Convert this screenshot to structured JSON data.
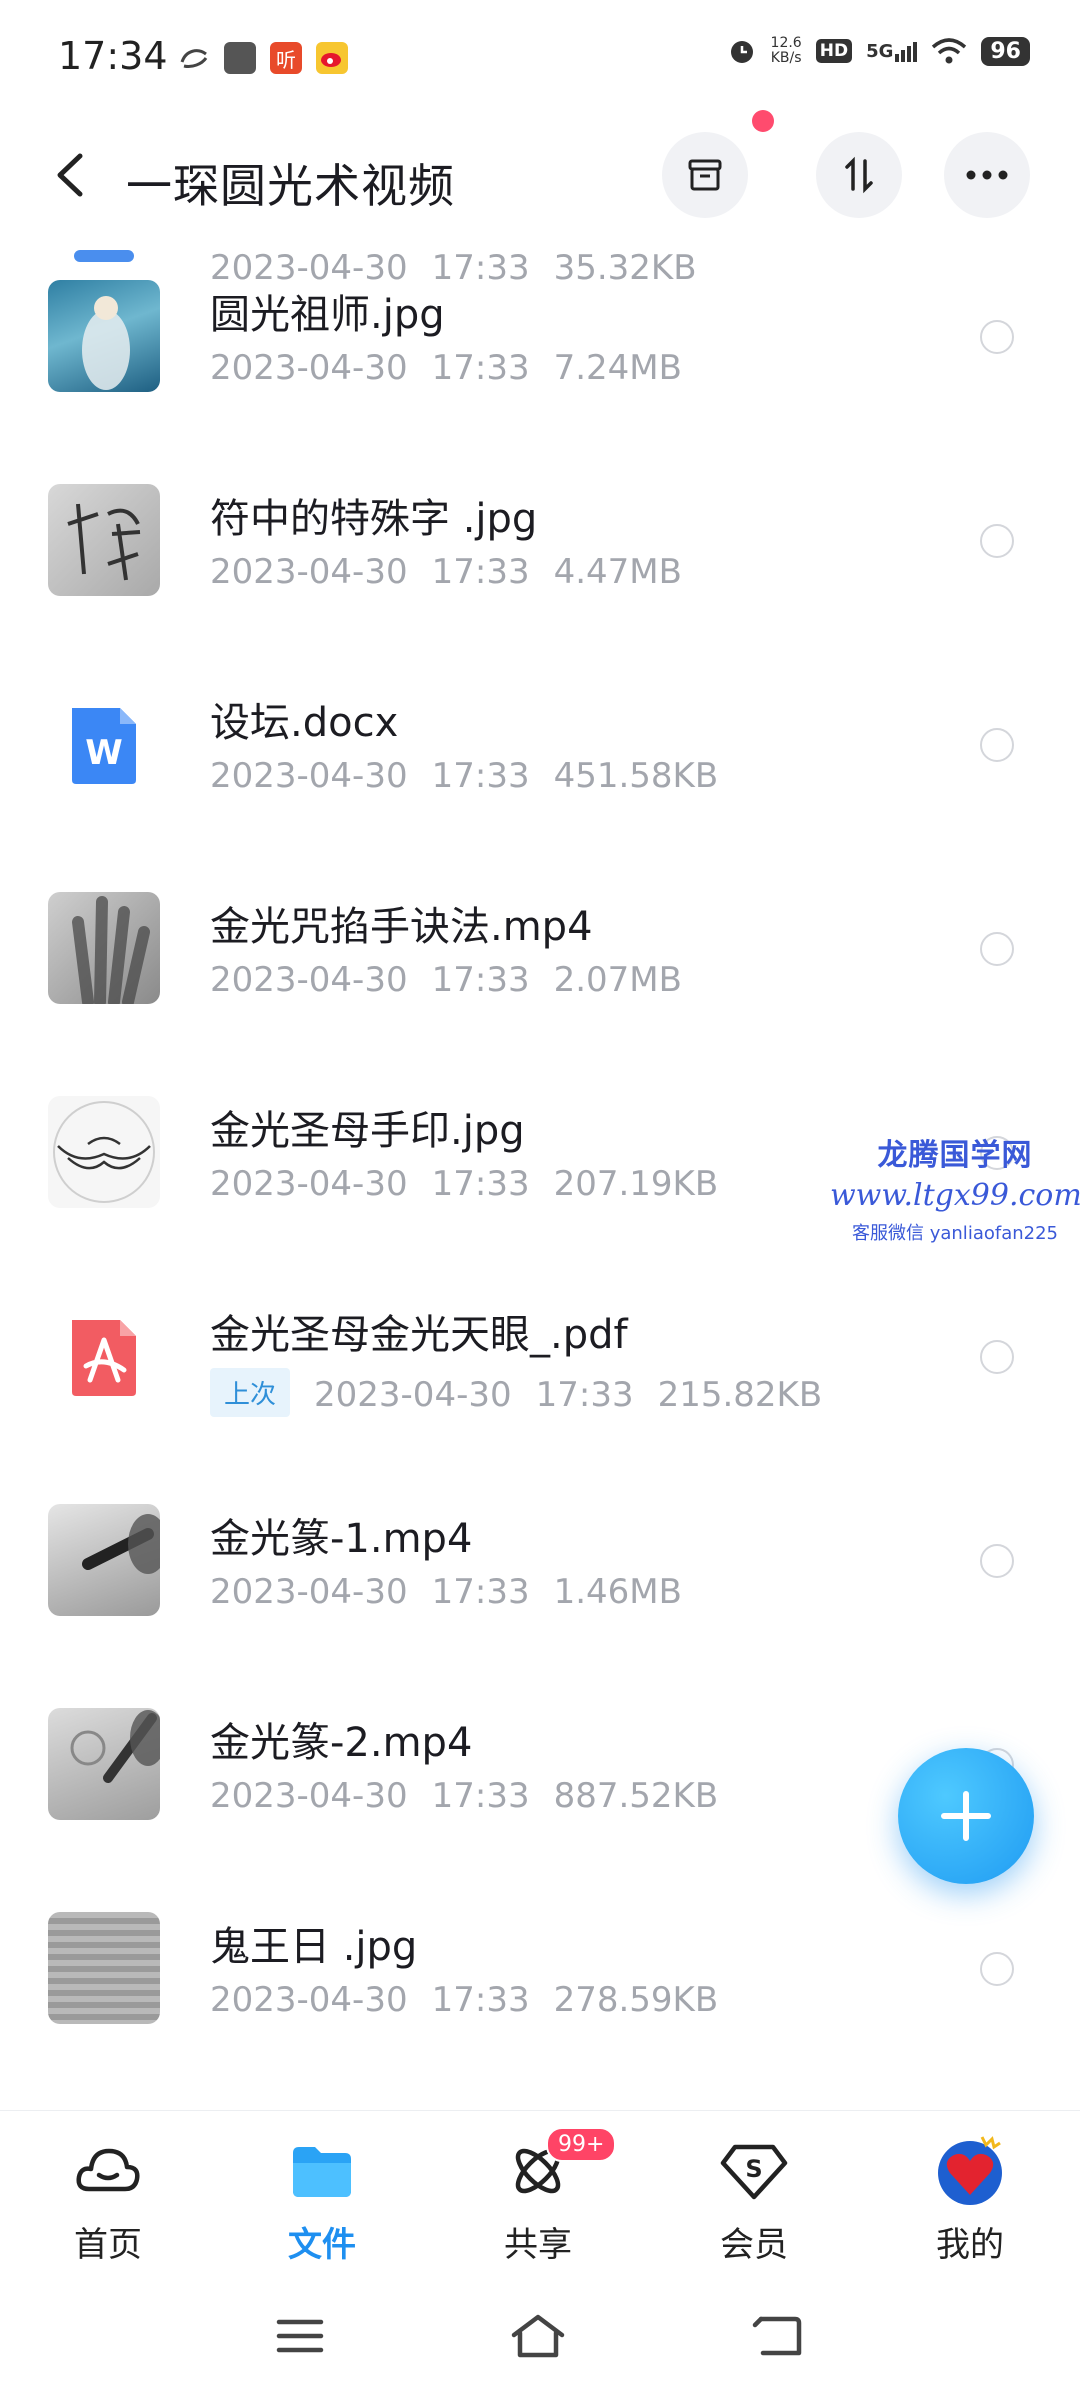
{
  "status_bar": {
    "time": "17:34",
    "left_icons": [
      "sync-icon",
      "app-icon",
      "ting-icon",
      "weibo-icon"
    ],
    "ting_label": "听",
    "net_speed_value": "12.6",
    "net_speed_unit": "KB/s",
    "hd_label": "HD",
    "network_label": "5G",
    "battery": "96"
  },
  "header": {
    "title": "一琛圆光术视频"
  },
  "files": [
    {
      "name": "",
      "date": "2023-04-30",
      "time": "17:33",
      "size": "35.32KB",
      "thumb": "partial-doc"
    },
    {
      "name": "圆光祖师.jpg",
      "date": "2023-04-30",
      "time": "17:33",
      "size": "7.24MB",
      "thumb": "image"
    },
    {
      "name": "符中的特殊字 .jpg",
      "date": "2023-04-30",
      "time": "17:33",
      "size": "4.47MB",
      "thumb": "image"
    },
    {
      "name": "设坛.docx",
      "date": "2023-04-30",
      "time": "17:33",
      "size": "451.58KB",
      "thumb": "word-icon"
    },
    {
      "name": "金光咒掐手诀法.mp4",
      "date": "2023-04-30",
      "time": "17:33",
      "size": "2.07MB",
      "thumb": "video"
    },
    {
      "name": "金光圣母手印.jpg",
      "date": "2023-04-30",
      "time": "17:33",
      "size": "207.19KB",
      "thumb": "image"
    },
    {
      "name": "金光圣母金光天眼_.pdf",
      "badge": "上次",
      "date": "2023-04-30",
      "time": "17:33",
      "size": "215.82KB",
      "thumb": "pdf-icon"
    },
    {
      "name": "金光篆-1.mp4",
      "date": "2023-04-30",
      "time": "17:33",
      "size": "1.46MB",
      "thumb": "video"
    },
    {
      "name": "金光篆-2.mp4",
      "date": "2023-04-30",
      "time": "17:33",
      "size": "887.52KB",
      "thumb": "video"
    },
    {
      "name": "鬼王日 .jpg",
      "date": "2023-04-30",
      "time": "17:33",
      "size": "278.59KB",
      "thumb": "image"
    }
  ],
  "watermark": {
    "line1": "龙腾国学网",
    "line2": "www.ltgx99.com",
    "line3": "客服微信 yanliaofan225"
  },
  "bottom_nav": [
    {
      "label": "首页",
      "icon": "cloud-icon",
      "active": false
    },
    {
      "label": "文件",
      "icon": "folder-icon",
      "active": true
    },
    {
      "label": "共享",
      "icon": "share-atom-icon",
      "active": false,
      "badge": "99+"
    },
    {
      "label": "会员",
      "icon": "vip-diamond-icon",
      "active": false
    },
    {
      "label": "我的",
      "icon": "avatar-heart-icon",
      "active": false
    }
  ],
  "colors": {
    "accent": "#1e8ff0",
    "badge": "#ff4466",
    "meta_text": "#a3a6ad"
  }
}
